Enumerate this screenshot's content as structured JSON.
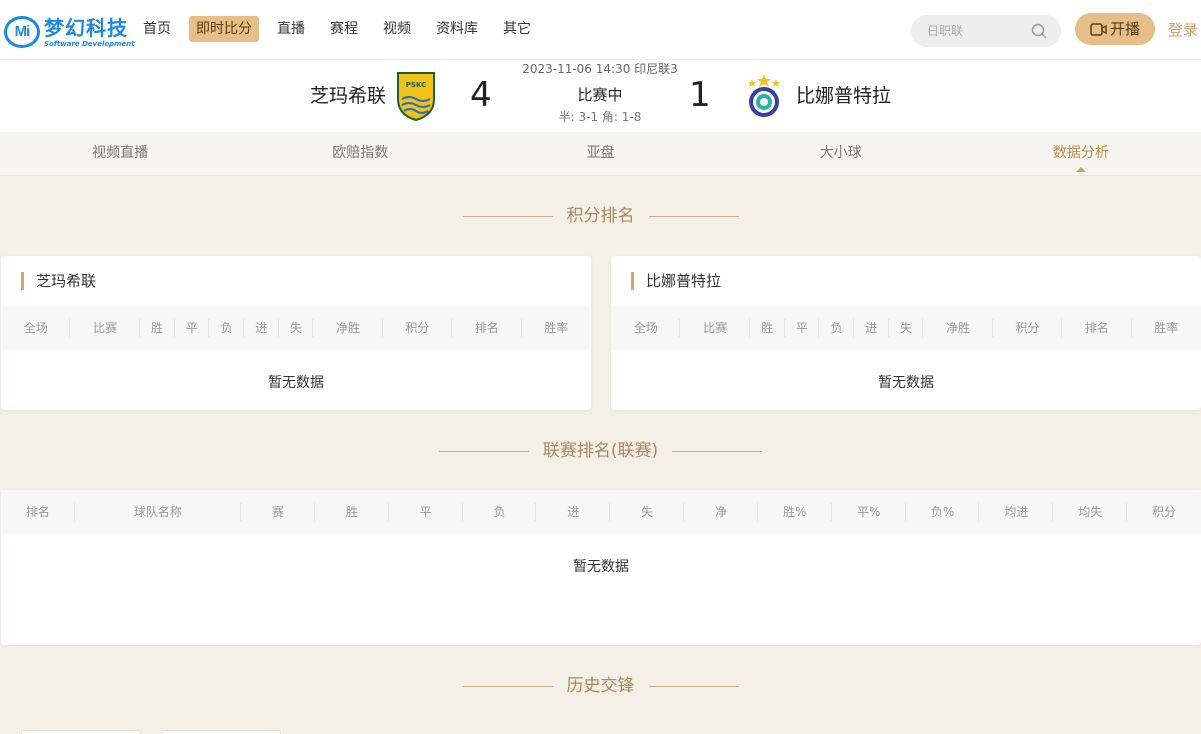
{
  "nav": {
    "logo_text": "梦幻科技",
    "logo_sub": "Software Development",
    "logo_mark": "Mi",
    "items": [
      {
        "label": "首页"
      },
      {
        "label": "即时比分",
        "active": true
      },
      {
        "label": "直播"
      },
      {
        "label": "赛程"
      },
      {
        "label": "视频"
      },
      {
        "label": "资料库"
      },
      {
        "label": "其它"
      }
    ],
    "search_placeholder": "日职联",
    "live_label": "开播",
    "login_label": "登录"
  },
  "match": {
    "datetime_league": "2023-11-06 14:30 印尼联3",
    "status": "比赛中",
    "half_corner": "半: 3-1   角: 1-8",
    "home_team": "芝玛希联",
    "away_team": "比娜普特拉",
    "home_score": "4",
    "away_score": "1",
    "home_crest_text": "PSKC"
  },
  "tabs": [
    "视频直播",
    "欧赔指数",
    "亚盘",
    "大小球",
    "数据分析"
  ],
  "active_tab": 4,
  "sections": {
    "standings_title": "积分排名",
    "league_title": "联赛排名(联赛)",
    "history_title": "历史交锋"
  },
  "standings": {
    "headers": [
      "全场",
      "比赛",
      "胜",
      "平",
      "负",
      "进",
      "失",
      "净胜",
      "积分",
      "排名",
      "胜率"
    ],
    "home_card_title": "芝玛希联",
    "away_card_title": "比娜普特拉",
    "empty_text": "暂无数据"
  },
  "league_table": {
    "headers": [
      "排名",
      "球队名称",
      "赛",
      "胜",
      "平",
      "负",
      "进",
      "失",
      "净",
      "胜%",
      "平%",
      "负%",
      "均进",
      "均失",
      "积分"
    ],
    "empty_text": "暂无数据"
  },
  "colors": {
    "accent": "#e5bf87",
    "accent_text": "#b98c4a",
    "brand_blue": "#1e88e5"
  }
}
